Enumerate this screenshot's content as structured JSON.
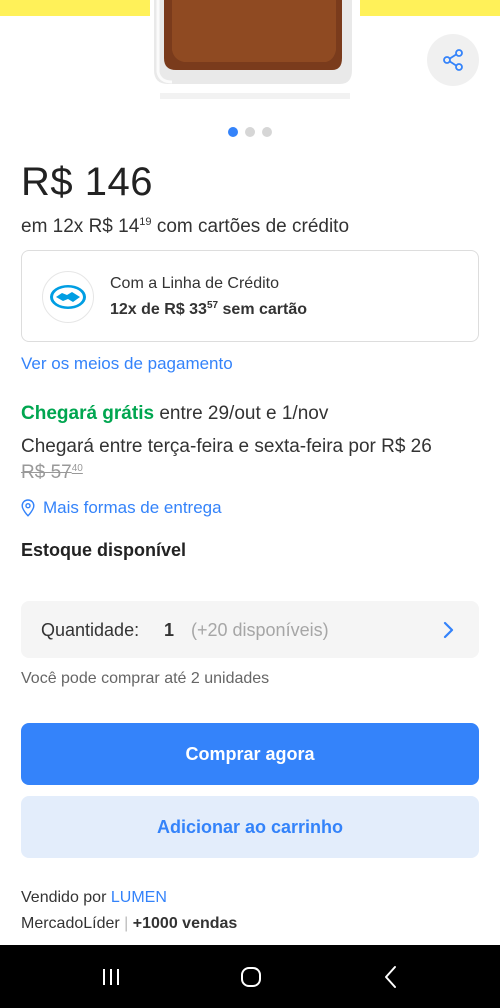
{
  "colors": {
    "accent": "#3483fa",
    "brand_yellow": "#fff159",
    "free_shipping_green": "#00a650"
  },
  "gallery": {
    "image_icon": "perfume-bottle-image",
    "share_icon": "share-icon",
    "pages": 3,
    "current_page": 1
  },
  "price": {
    "main": "R$ 146",
    "installments_prefix": "em 12x R$ 14",
    "installments_cents": "19",
    "installments_suffix": " com cartões de crédito"
  },
  "credit_line": {
    "icon": "mercado-pago-handshake-icon",
    "title": "Com a Linha de Crédito",
    "sub_prefix": "12x de R$ 33",
    "sub_cents": "57",
    "sub_suffix": " sem cartão"
  },
  "payment_link": "Ver os meios de pagamento",
  "shipping": {
    "free_label": "Chegará grátis",
    "free_dates": " entre 29/out e 1/nov",
    "paid_text": "Chegará entre terça-feira e sexta-feira por R$ 26",
    "old_price": "R$ 57",
    "old_price_cents": "40",
    "more_options_icon": "location-pin-icon",
    "more_options": "Mais formas de entrega"
  },
  "stock": "Estoque disponível",
  "quantity": {
    "label": "Quantidade:",
    "value": "1",
    "available": "(+20 disponíveis)",
    "chevron_icon": "chevron-right-icon"
  },
  "purchase_limit": "Você pode comprar até 2 unidades",
  "buttons": {
    "buy_now": "Comprar agora",
    "add_to_cart": "Adicionar ao carrinho"
  },
  "seller": {
    "sold_by": "Vendido por ",
    "name": "LUMEN",
    "status": "MercadoLíder",
    "separator": "|",
    "sales": "+1000 vendas"
  },
  "system_nav": {
    "recent_icon": "recent-apps-icon",
    "home_icon": "home-icon",
    "back_icon": "back-icon"
  }
}
